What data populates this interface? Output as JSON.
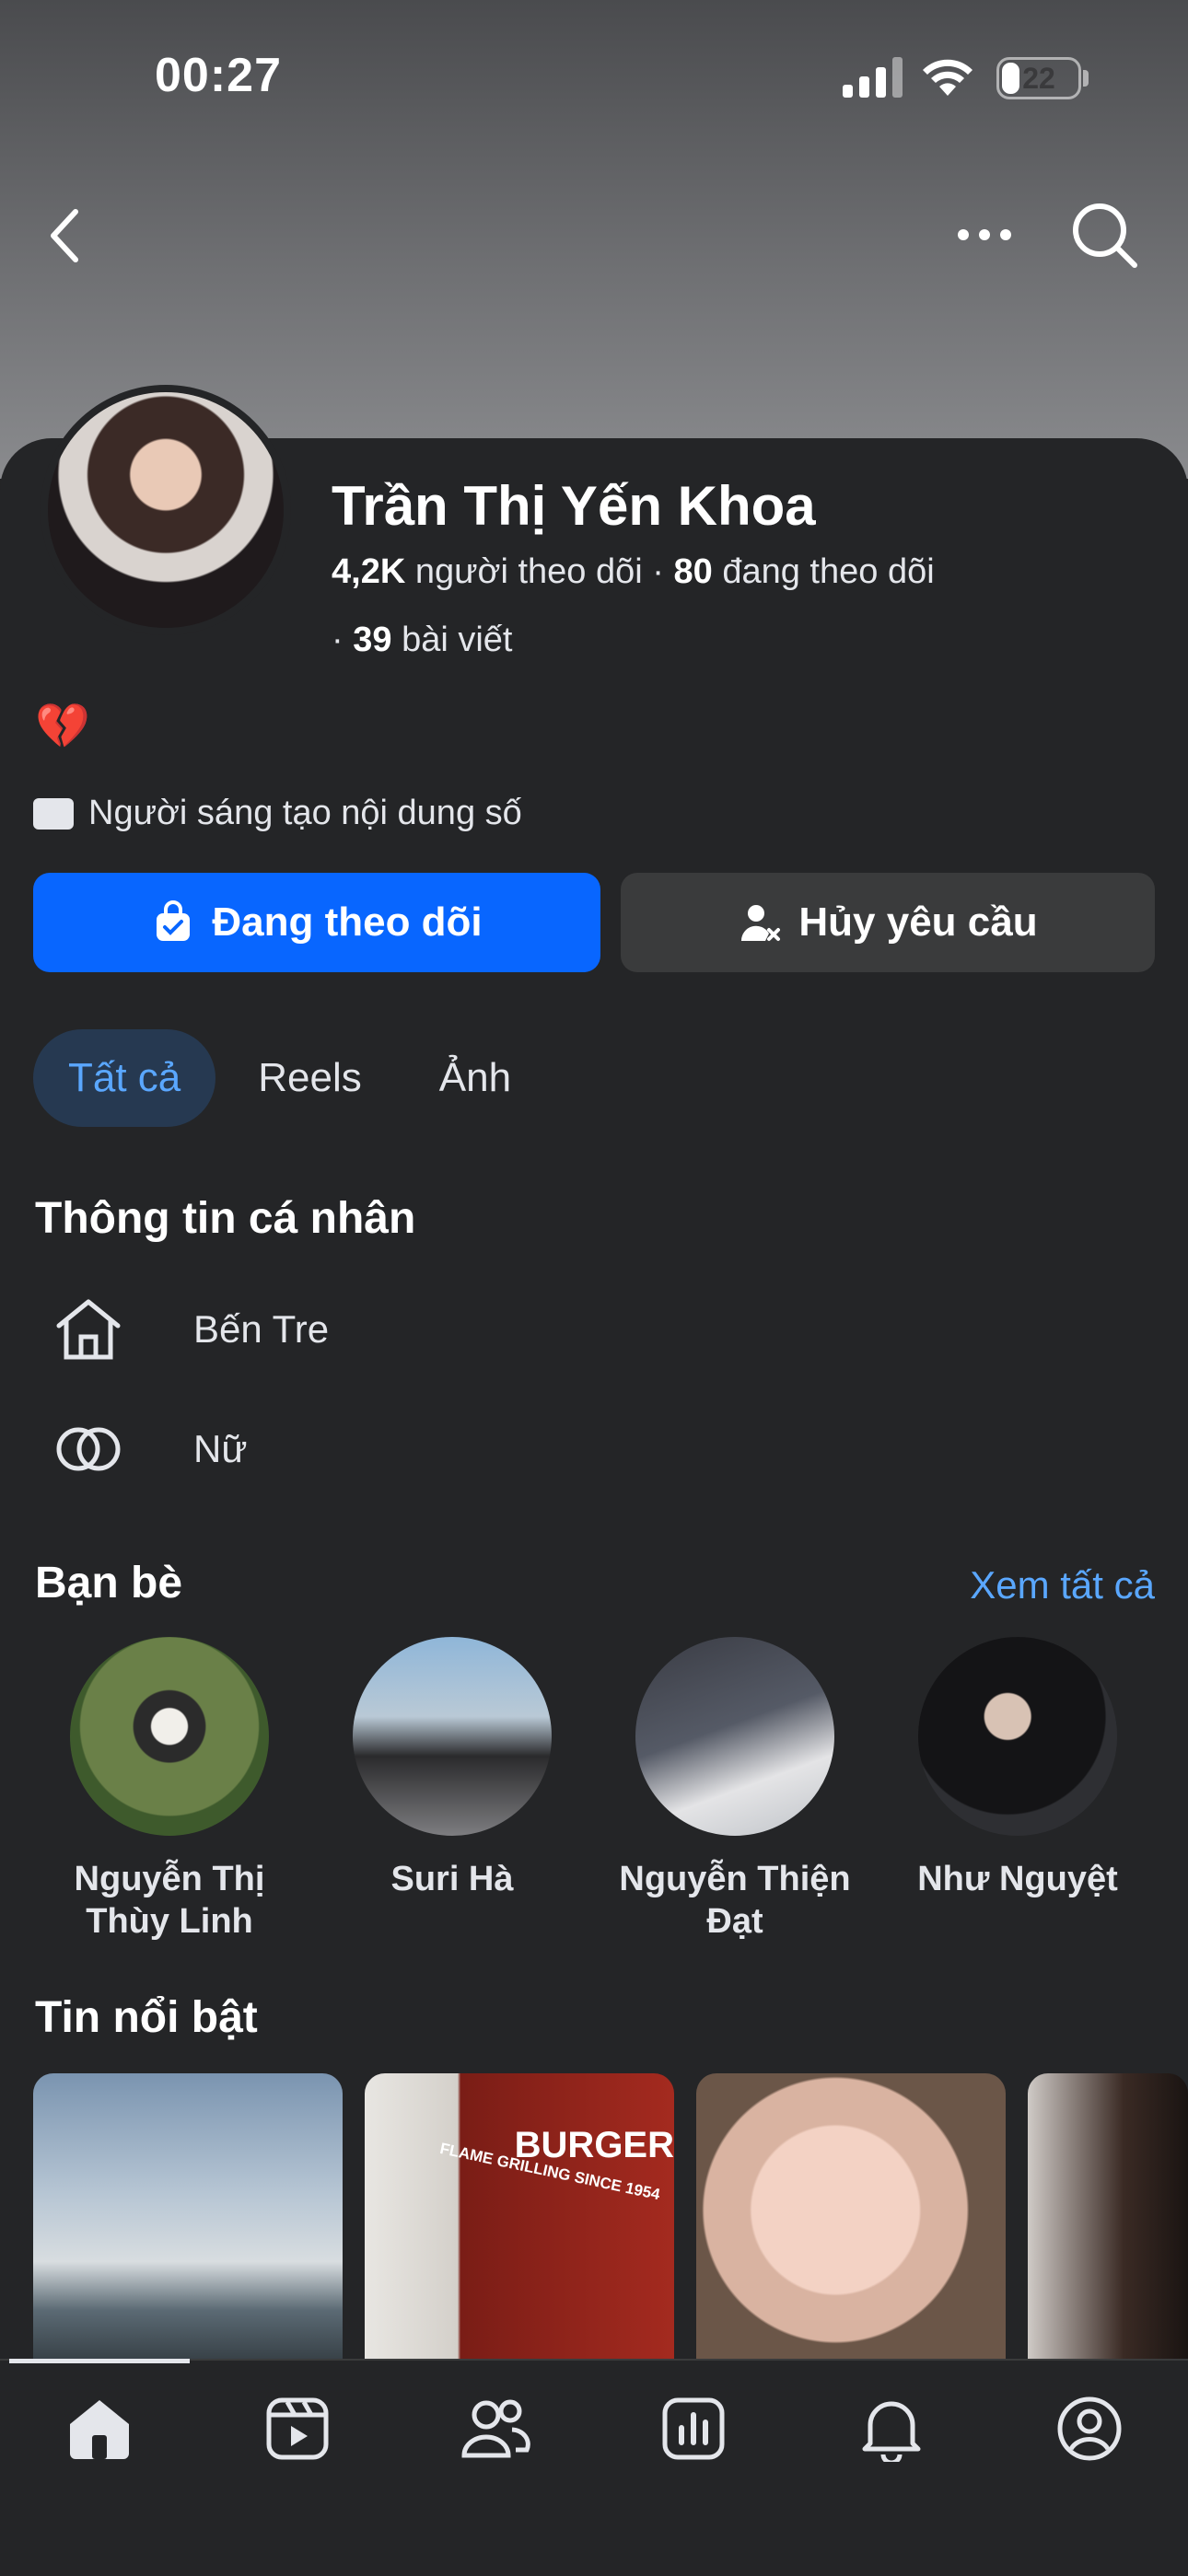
{
  "status_bar": {
    "time": "00:27",
    "battery": "22"
  },
  "profile": {
    "name": "Trần Thị Yến Khoa",
    "followers_count": "4,2K",
    "followers_label": "người theo dõi",
    "following_count": "80",
    "following_label": "đang theo dõi",
    "posts_count": "39",
    "posts_label": "bài viết",
    "bio_emoji": "💔",
    "category": "Người sáng tạo nội dung số"
  },
  "actions": {
    "following_label": "Đang theo dõi",
    "cancel_request_label": "Hủy yêu cầu"
  },
  "tabs": [
    {
      "label": "Tất cả"
    },
    {
      "label": "Reels"
    },
    {
      "label": "Ảnh"
    }
  ],
  "personal_info": {
    "title": "Thông tin cá nhân",
    "hometown": "Bến Tre",
    "gender": "Nữ"
  },
  "friends": {
    "title": "Bạn bè",
    "see_all": "Xem tất cả",
    "items": [
      {
        "name": "Nguyễn Thị Thùy Linh"
      },
      {
        "name": "Suri Hà"
      },
      {
        "name": "Nguyễn Thiện Đạt"
      },
      {
        "name": "Như Nguyệt"
      }
    ]
  },
  "highlights": {
    "title": "Tin nổi bật",
    "story_sign_text": "BURGER",
    "story_sign_sub": "FLAME GRILLING SINCE 1954"
  },
  "icons": {
    "back": "chevron-left-icon",
    "more": "more-horizontal-icon",
    "search": "search-icon",
    "home": "home-icon",
    "reels": "video-icon",
    "friends": "friends-icon",
    "dashboard": "dashboard-icon",
    "notifications": "bell-icon",
    "profile": "profile-icon"
  },
  "colors": {
    "accent": "#0866ff",
    "link": "#5aa7ff",
    "background": "#242527"
  }
}
